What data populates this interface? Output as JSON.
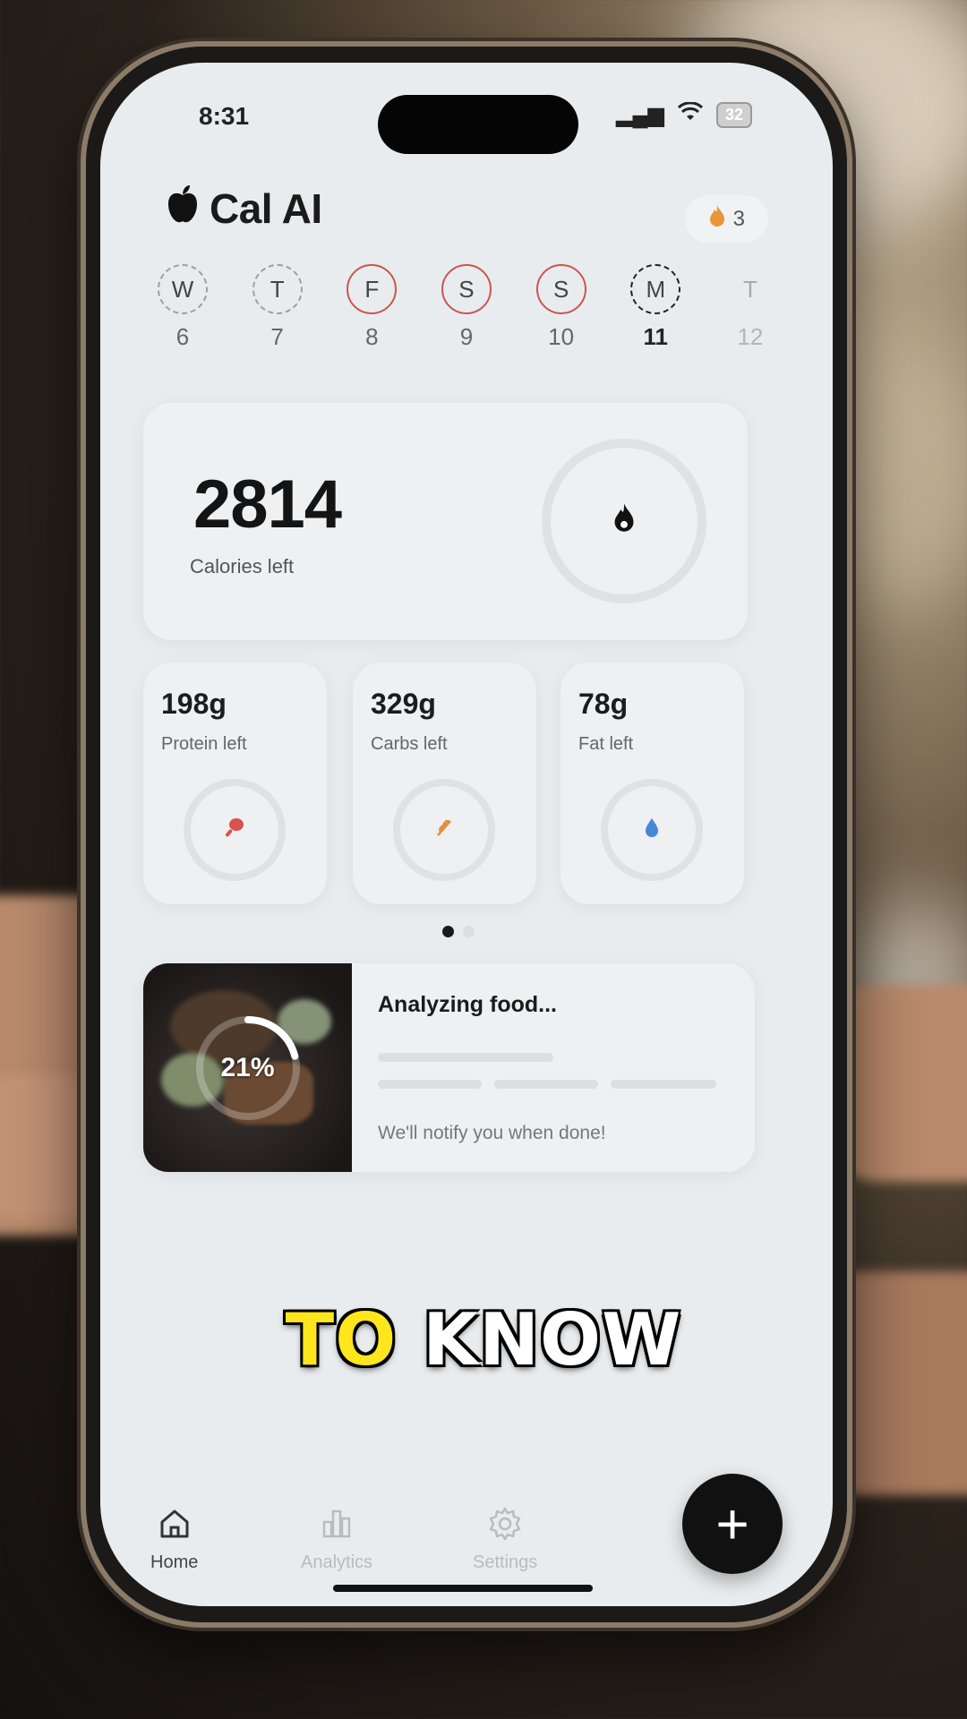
{
  "status_bar": {
    "time": "8:31",
    "battery": "32"
  },
  "app": {
    "title": "Cal AI",
    "streak_count": "3"
  },
  "week": [
    {
      "letter": "W",
      "number": "6",
      "style": "dashed"
    },
    {
      "letter": "T",
      "number": "7",
      "style": "dashed"
    },
    {
      "letter": "F",
      "number": "8",
      "style": "red"
    },
    {
      "letter": "S",
      "number": "9",
      "style": "red"
    },
    {
      "letter": "S",
      "number": "10",
      "style": "red"
    },
    {
      "letter": "M",
      "number": "11",
      "style": "dark-dashed"
    },
    {
      "letter": "T",
      "number": "12",
      "style": "none"
    }
  ],
  "calories": {
    "value": "2814",
    "label": "Calories left",
    "icon": "flame-icon"
  },
  "macros": [
    {
      "value": "198g",
      "label": "Protein left",
      "icon": "drumstick-icon",
      "color": "#d9524b"
    },
    {
      "value": "329g",
      "label": "Carbs left",
      "icon": "wheat-icon",
      "color": "#e0913a"
    },
    {
      "value": "78g",
      "label": "Fat left",
      "icon": "droplet-icon",
      "color": "#4a86d8"
    }
  ],
  "pager": {
    "pages": 2,
    "active": 0
  },
  "analyzing": {
    "title": "Analyzing food...",
    "progress_label": "21%",
    "progress": 0.21,
    "note": "We'll notify you when done!"
  },
  "caption": {
    "yellow": "TO",
    "white": "KNOW"
  },
  "tabs": [
    {
      "label": "Home",
      "icon": "home-icon",
      "active": true
    },
    {
      "label": "Analytics",
      "icon": "bar-chart-icon",
      "active": false
    },
    {
      "label": "Settings",
      "icon": "gear-icon",
      "active": false
    }
  ],
  "fab": {
    "label": "+"
  },
  "colors": {
    "accent": "#111111",
    "streak_red": "#c9564f",
    "caption_yellow": "#ffe61c"
  }
}
